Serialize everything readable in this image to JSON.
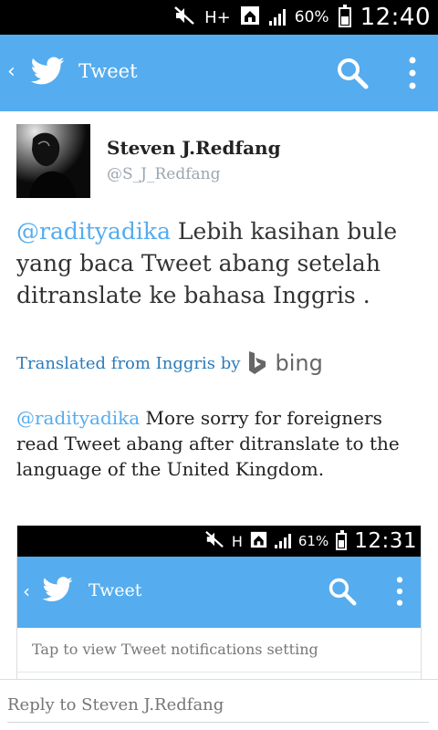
{
  "status_bar": {
    "battery_pct": "60%",
    "time": "12:40",
    "network": "H+",
    "battery_level": 0.6,
    "icons": [
      "mute-icon",
      "hplus-data-icon",
      "home-icon",
      "signal-icon",
      "battery-icon"
    ]
  },
  "action_bar": {
    "title": "Tweet",
    "back_glyph": "‹",
    "color": "#55acee",
    "icons": [
      "twitter-bird-icon",
      "search-icon",
      "overflow-menu-icon"
    ]
  },
  "tweet": {
    "author_name": "Steven J.Redfang",
    "author_handle": "@S_J_Redfang",
    "mention": "@radityadika",
    "text": " Lebih kasihan bule yang baca Tweet abang setelah ditranslate ke bahasa Inggris .",
    "translated_label": "Translated from Inggris by",
    "translator": "bing",
    "translation_mention": "@radityadika",
    "translation_text": " More sorry for foreigners read Tweet abang after ditranslate to the language of the United Kingdom."
  },
  "embedded_screenshot": {
    "status_bar": {
      "battery_pct": "61%",
      "time": "12:31",
      "network": "H",
      "battery_level": 0.61
    },
    "action_bar": {
      "title": "Tweet",
      "back_glyph": "‹"
    },
    "notice": "Tap to view Tweet notifications setting"
  },
  "reply": {
    "placeholder": "Reply to Steven J.Redfang"
  }
}
